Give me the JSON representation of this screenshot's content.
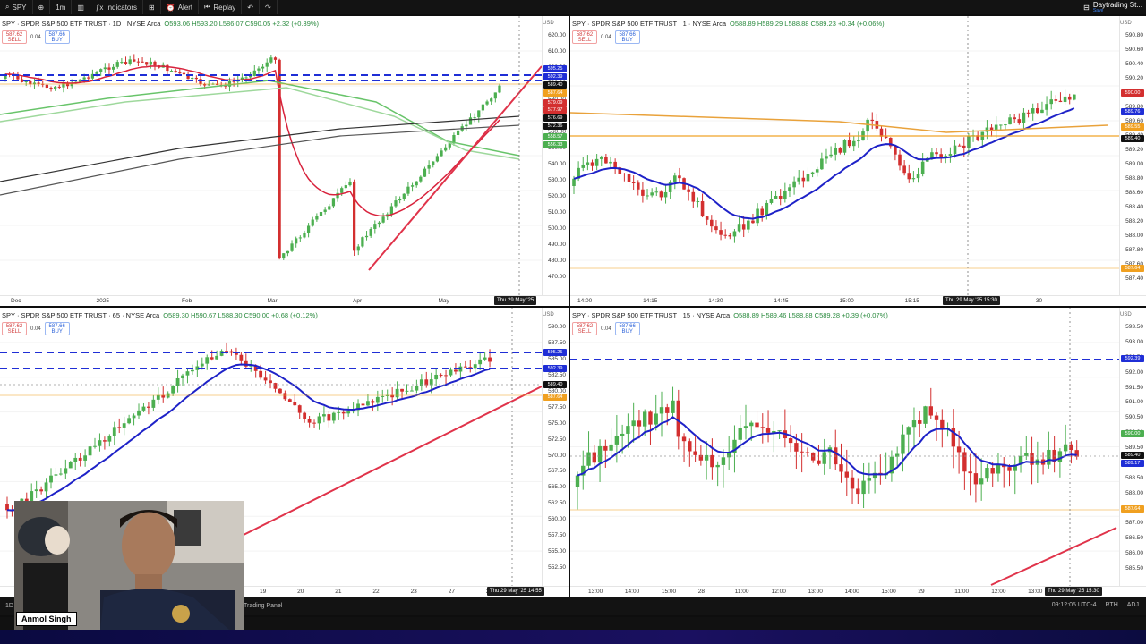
{
  "toolbar": {
    "symbol": "SPY",
    "interval": "1m",
    "indicators_label": "Indicators",
    "alert_label": "Alert",
    "replay_label": "Replay",
    "brand_label": "Daytrading St...",
    "brand_sub": "Save"
  },
  "colors": {
    "up": "#4caf50",
    "down": "#d32f2f",
    "ema_blue": "#1e22c8",
    "trend_red": "#e0334a",
    "level_blue": "#1f2ed6",
    "orange": "#f0a020"
  },
  "trade": {
    "sell_price": "587.62",
    "sell_label": "SELL",
    "spread": "0.04",
    "buy_price": "587.66",
    "buy_label": "BUY"
  },
  "currency": "USD",
  "panes": [
    {
      "title": "SPY · SPDR S&P 500 ETF TRUST · 1D · NYSE Arca",
      "ohlc": "O593.06 H593.20 L586.07 C590.05 +2.32 (+0.39%)",
      "price_ticks": [
        "620.00",
        "610.00",
        "600.00",
        "590.00",
        "580.00",
        "570.00",
        "560.00",
        "550.00",
        "540.00",
        "530.00",
        "520.00",
        "510.00",
        "500.00",
        "490.00",
        "480.00",
        "470.00"
      ],
      "tags": [
        {
          "text": "595.25",
          "color": "#1f2ed6"
        },
        {
          "text": "592.39",
          "color": "#1f2ed6"
        },
        {
          "text": "589.40",
          "color": "#111111"
        },
        {
          "text": "587.64",
          "color": "#f0a020"
        },
        {
          "text": "579.09",
          "color": "#d32f2f"
        },
        {
          "text": "577.97",
          "color": "#d32f2f"
        },
        {
          "text": "576.69",
          "color": "#111111"
        },
        {
          "text": "572.36",
          "color": "#111111"
        },
        {
          "text": "558.57",
          "color": "#4caf50"
        },
        {
          "text": "556.33",
          "color": "#4caf50"
        }
      ],
      "time_ticks": [
        "Dec",
        "2025",
        "Feb",
        "Mar",
        "Apr",
        "May"
      ],
      "crosshair": "Thu 29 May '25"
    },
    {
      "title": "SPY · SPDR S&P 500 ETF TRUST · 1 · NYSE Arca",
      "ohlc": "O588.89 H589.29 L588.88 C589.23 +0.34 (+0.06%)",
      "price_ticks": [
        "590.80",
        "590.60",
        "590.40",
        "590.20",
        "590.00",
        "589.80",
        "589.60",
        "589.40",
        "589.20",
        "589.00",
        "588.80",
        "588.60",
        "588.40",
        "588.20",
        "588.00",
        "587.80",
        "587.60",
        "587.40"
      ],
      "tags": [
        {
          "text": "590.00",
          "color": "#d32f2f"
        },
        {
          "text": "589.76",
          "color": "#1f2ed6"
        },
        {
          "text": "589.55",
          "color": "#f0a020"
        },
        {
          "text": "589.40",
          "color": "#111111"
        },
        {
          "text": "587.64",
          "color": "#f0a020"
        }
      ],
      "time_ticks": [
        "14:00",
        "14:15",
        "14:30",
        "14:45",
        "15:00",
        "15:15",
        "15:45",
        "30"
      ],
      "crosshair": "Thu 29 May '25 15:30"
    },
    {
      "title": "SPY · SPDR S&P 500 ETF TRUST · 65 · NYSE Arca",
      "ohlc": "O589.30 H590.67 L588.30 C590.00 +0.68 (+0.12%)",
      "price_ticks": [
        "590.00",
        "587.50",
        "585.00",
        "582.50",
        "580.00",
        "577.50",
        "575.00",
        "572.50",
        "570.00",
        "567.50",
        "565.00",
        "562.50",
        "560.00",
        "557.50",
        "555.00",
        "552.50"
      ],
      "tags": [
        {
          "text": "595.25",
          "color": "#1f2ed6"
        },
        {
          "text": "592.39",
          "color": "#1f2ed6"
        },
        {
          "text": "589.40",
          "color": "#111111"
        },
        {
          "text": "587.64",
          "color": "#f0a020"
        }
      ],
      "time_ticks": [
        "19",
        "20",
        "21",
        "22",
        "23",
        "27",
        "28"
      ],
      "crosshair": "Thu 29 May '25 14:55"
    },
    {
      "title": "SPY · SPDR S&P 500 ETF TRUST · 15 · NYSE Arca",
      "ohlc": "O588.89 H589.46 L588.88 C589.28 +0.39 (+0.07%)",
      "price_ticks": [
        "593.50",
        "593.00",
        "592.50",
        "592.00",
        "591.50",
        "591.00",
        "590.50",
        "590.00",
        "589.50",
        "589.00",
        "588.50",
        "588.00",
        "587.50",
        "587.00",
        "586.50",
        "586.00",
        "585.50"
      ],
      "tags": [
        {
          "text": "592.39",
          "color": "#1f2ed6"
        },
        {
          "text": "590.00",
          "color": "#4caf50"
        },
        {
          "text": "589.40",
          "color": "#111111"
        },
        {
          "text": "589.17",
          "color": "#1f2ed6"
        },
        {
          "text": "587.64",
          "color": "#f0a020"
        }
      ],
      "time_ticks": [
        "13:00",
        "14:00",
        "15:00",
        "28",
        "11:00",
        "12:00",
        "13:00",
        "14:00",
        "15:00",
        "29",
        "11:00",
        "12:00",
        "13:00",
        "14:00"
      ],
      "crosshair": "Thu 29 May '25 15:30"
    }
  ],
  "bottom": {
    "trading_panel": "Trading Panel",
    "clock": "09:12:05 UTC-4",
    "rth": "RTH",
    "adj": "ADJ",
    "range_left": "1D"
  },
  "streamer": {
    "name": "Anmol Singh"
  }
}
